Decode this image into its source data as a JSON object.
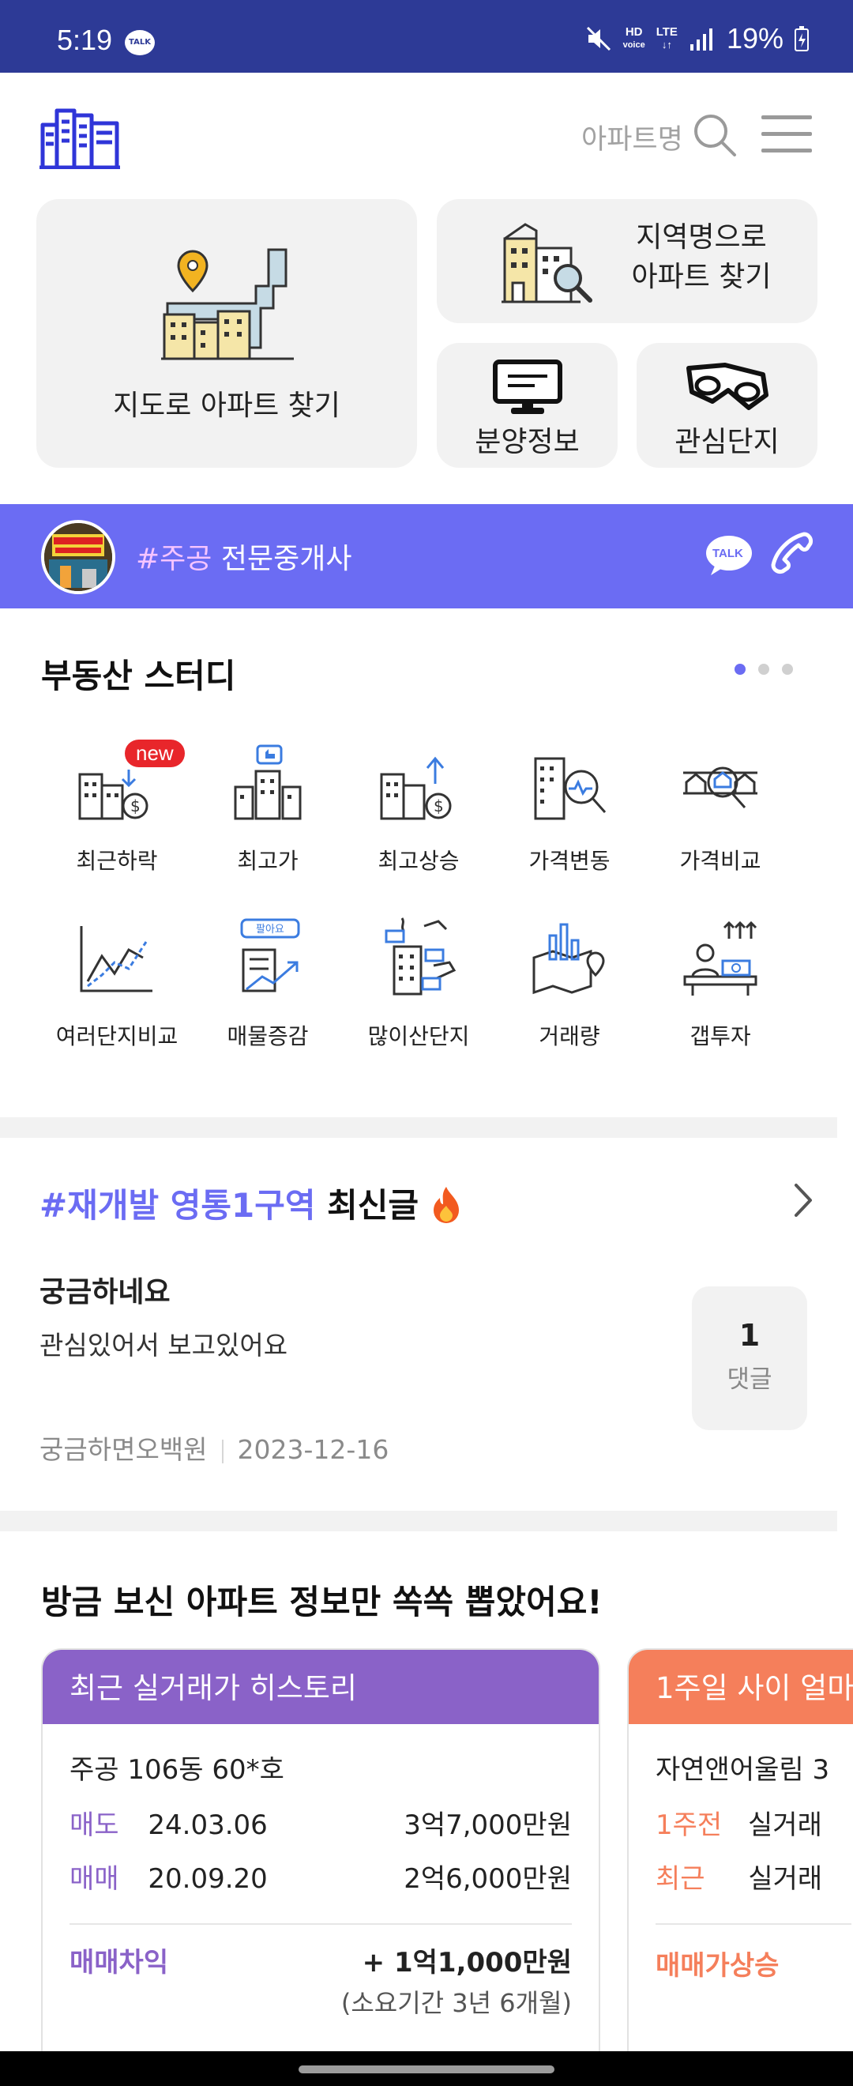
{
  "status_bar": {
    "time": "5:19",
    "talk_badge": "TALK",
    "hd_label": "HD",
    "voice_label": "voice",
    "lte_label": "LTE",
    "battery": "19%"
  },
  "header": {
    "search_placeholder": "아파트명"
  },
  "tiles": {
    "map": "지도로 아파트 찾기",
    "region_line1": "지역명으로",
    "region_line2": "아파트 찾기",
    "sale": "분양정보",
    "favorites": "관심단지"
  },
  "broker": {
    "tag": "#주공",
    "label": "전문중개사",
    "talk_label": "TALK"
  },
  "study": {
    "title": "부동산 스터디",
    "new_badge": "new",
    "items": [
      "최근하락",
      "최고가",
      "최고상승",
      "가격변동",
      "가격비교",
      "여러단지비교",
      "매물증감",
      "많이산단지",
      "거래량",
      "갭투자"
    ],
    "sell_tag": "팔아요"
  },
  "post": {
    "hashtag": "#재개발 영통1구역",
    "suffix": "최신글",
    "title": "궁금하네요",
    "body": "관심있어서 보고있어요",
    "author": "궁금하면오백원",
    "date": "2023-12-16",
    "comment_count": "1",
    "comment_label": "댓글"
  },
  "pick": {
    "title": "방금 보신 아파트 정보만 쏙쏙 뽑았어요!",
    "card1": {
      "header": "최근 실거래가 히스토리",
      "unit": "주공 106동 60*호",
      "rows": [
        {
          "type": "매도",
          "date": "24.03.06",
          "price": "3억7,000만원"
        },
        {
          "type": "매매",
          "date": "20.09.20",
          "price": "2억6,000만원"
        }
      ],
      "diff_label": "매매차익",
      "diff_value": "+ 1억1,000만원",
      "period": "(소요기간 3년 6개월)"
    },
    "card2": {
      "header": "1주일 사이 얼마",
      "unit": "자연앤어울림 3",
      "rows": [
        {
          "type": "1주전",
          "text": "실거래"
        },
        {
          "type": "최근",
          "text": "실거래"
        }
      ],
      "footer_label": "매매가상승"
    }
  },
  "colors": {
    "status_bar": "#2d3a96",
    "accent": "#6b6cf3",
    "purple": "#8a62c8",
    "orange": "#f57f5b"
  }
}
